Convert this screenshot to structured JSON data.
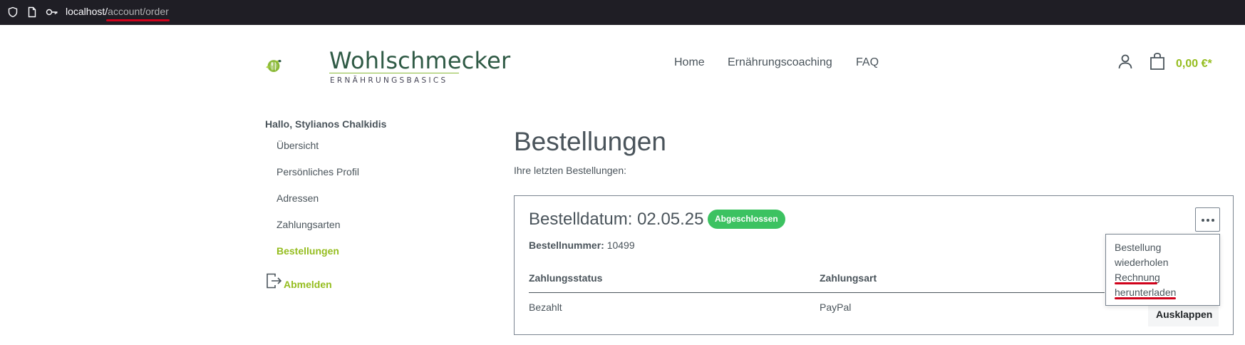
{
  "browser": {
    "url_host": "localhost/",
    "url_path": "account/order",
    "icons": [
      "shield-icon",
      "page-icon",
      "key-icon"
    ]
  },
  "header": {
    "logo_word": "Wohlschmecker",
    "logo_sub": "ERNÄHRUNGSBASICS",
    "nav": [
      "Home",
      "Ernährungscoaching",
      "FAQ"
    ],
    "cart_total": "0,00 €*",
    "accent": "#95bd1f"
  },
  "sidebar": {
    "greeting": "Hallo, Stylianos Chalkidis",
    "items": [
      "Übersicht",
      "Persönliches Profil",
      "Adressen",
      "Zahlungsarten",
      "Bestellungen"
    ],
    "active_index": 4,
    "logout": "Abmelden"
  },
  "main": {
    "title": "Bestellungen",
    "subtitle": "Ihre letzten Bestellungen:",
    "order": {
      "date_label": "Bestelldatum: 02.05.25",
      "status": "Abgeschlossen",
      "status_color": "#3cc261",
      "number_label": "Bestellnummer:",
      "number": "10499",
      "columns": [
        "Zahlungsstatus",
        "Zahlungsart"
      ],
      "values": [
        "Bezahlt",
        "PayPal"
      ],
      "menu": [
        "Bestellung",
        "wiederholen",
        "Rechnung",
        "herunterladen"
      ],
      "expand_label": "Ausklappen"
    }
  }
}
